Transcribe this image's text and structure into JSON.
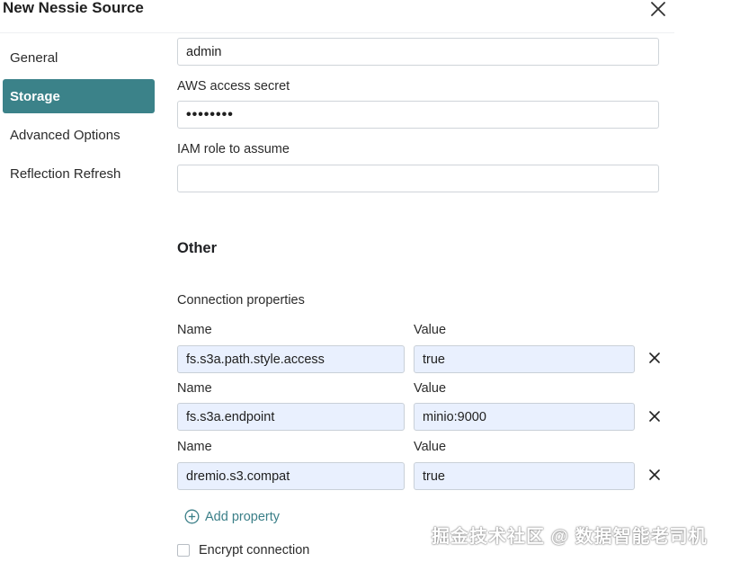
{
  "dialog": {
    "title": "New Nessie Source"
  },
  "sidebar": {
    "items": [
      {
        "label": "General"
      },
      {
        "label": "Storage"
      },
      {
        "label": "Advanced Options"
      },
      {
        "label": "Reflection Refresh"
      }
    ],
    "active": "Storage"
  },
  "storage": {
    "access_key_value": "admin",
    "access_secret_label": "AWS access secret",
    "access_secret_value": "••••••••",
    "iam_label": "IAM role to assume",
    "iam_value": ""
  },
  "other": {
    "title": "Other",
    "connection_properties_label": "Connection properties",
    "name_label": "Name",
    "value_label": "Value",
    "properties": [
      {
        "name": "fs.s3a.path.style.access",
        "value": "true"
      },
      {
        "name": "fs.s3a.endpoint",
        "value": "minio:9000"
      },
      {
        "name": "dremio.s3.compat",
        "value": "true"
      }
    ],
    "add_property_label": "Add property",
    "encrypt_label": "Encrypt connection",
    "encrypt_checked": false
  },
  "watermark": "掘金技术社区 @ 数据智能老司机",
  "icons": {
    "close": "close-icon",
    "remove": "remove-icon",
    "add": "plus-circle-icon"
  },
  "colors": {
    "accent": "#3b8289",
    "input_filled": "#e9f0fe",
    "link": "#3b7f88"
  }
}
